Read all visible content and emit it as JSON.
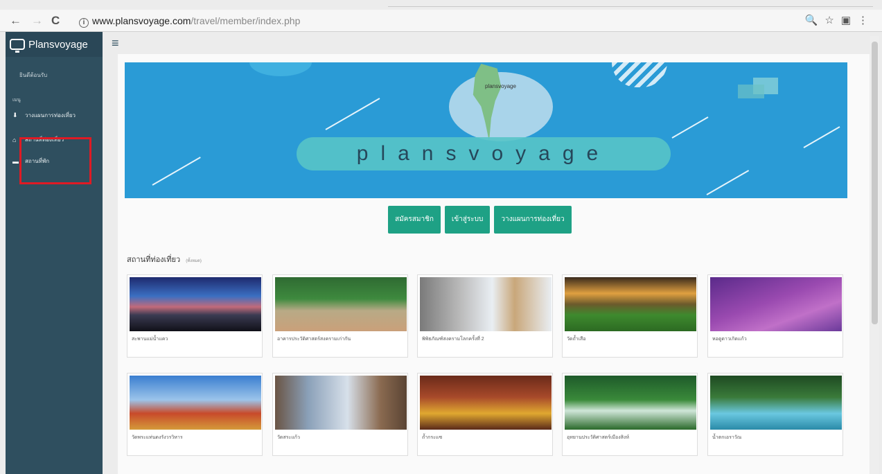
{
  "browser": {
    "back": "←",
    "forward": "→",
    "reload": "C",
    "info": "i",
    "url_domain": "www.plansvoyage.com",
    "url_path": "/travel/member/index.php",
    "icons": "🔍☆▣⋮"
  },
  "sidebar": {
    "brand": "Plansvoyage",
    "welcome": "ยินดีต้อนรับ",
    "section": "เมนู",
    "items": [
      {
        "icon": "⬇",
        "label": "วางแผนการท่องเที่ยว",
        "icon_name": "download-icon"
      },
      {
        "icon": "⌂",
        "label": "สถานที่ท่องเที่ยว",
        "icon_name": "home-icon"
      },
      {
        "icon": "▬",
        "label": "สถานที่พัก",
        "icon_name": "bed-icon"
      }
    ],
    "highlight_color": "#e01a24"
  },
  "header": {
    "menu_icon": "≡"
  },
  "banner": {
    "title": "plansvoyage",
    "map_label": "plansvoyage"
  },
  "buttons": [
    "สมัครสมาชิก",
    "เข้าสู่ระบบ",
    "วางแผนการท่องเที่ยว"
  ],
  "section": {
    "title": "สถานที่ท่องเที่ยว",
    "subtitle": "(ทั้งหมด)"
  },
  "cards": [
    {
      "caption": "สะพานแม่น้ำแคว"
    },
    {
      "caption": "อาคารประวัติศาสตร์สงครามเก่ากัน"
    },
    {
      "caption": "พิพิธภัณฑ์สงครามโลกครั้งที่ 2"
    },
    {
      "caption": "วัดถ้ำเสือ"
    },
    {
      "caption": "หอดูดาวเกิดแก้ว"
    },
    {
      "caption": "วัดพระแท่นดงรังวรวิหาร"
    },
    {
      "caption": "วัดสระแก้ว"
    },
    {
      "caption": "ถ้ำกระแซ"
    },
    {
      "caption": "อุทยานประวัติศาสตร์เมืองสิงห์"
    },
    {
      "caption": "น้ำตกเอราวัณ"
    }
  ],
  "colors": {
    "accent": "#1ea185",
    "sidebar": "#2f4f5f",
    "banner": "#2a9bd6"
  }
}
